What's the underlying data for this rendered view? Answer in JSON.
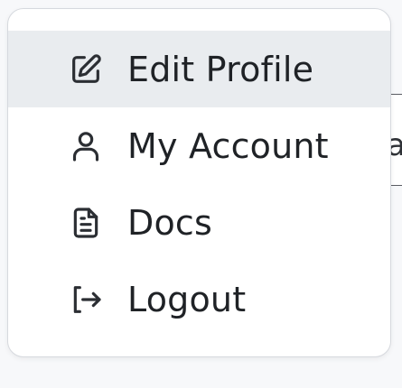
{
  "background": {
    "peek_text": "a"
  },
  "menu": {
    "items": [
      {
        "label": "Edit Profile",
        "icon": "edit-icon",
        "active": true
      },
      {
        "label": "My Account",
        "icon": "user-icon",
        "active": false
      },
      {
        "label": "Docs",
        "icon": "document-icon",
        "active": false
      },
      {
        "label": "Logout",
        "icon": "logout-icon",
        "active": false
      }
    ]
  },
  "colors": {
    "active_background": "#e9ecef",
    "text": "#1f2226",
    "border": "#d6d9de"
  }
}
